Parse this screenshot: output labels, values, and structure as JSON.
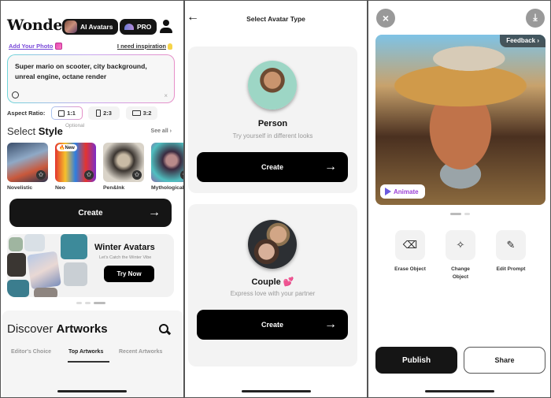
{
  "panel1": {
    "logo": "Wonder",
    "ai_avatars_label": "AI Avatars",
    "pro_label": "PRO",
    "add_photo_label": "Add Your Photo",
    "inspiration_label": "I need inspiration",
    "prompt_value": "Super mario on scooter, city background, unreal engine, octane render",
    "clear_symbol": "×",
    "aspect_ratio_label": "Aspect Ratio:",
    "aspect_ratios": [
      {
        "label": "1:1",
        "selected": true
      },
      {
        "label": "2:3",
        "selected": false
      },
      {
        "label": "3:2",
        "selected": false
      }
    ],
    "select_label": "Select",
    "style_label": "Style",
    "optional_label": "Optional",
    "see_all_label": "See all ›",
    "styles": [
      {
        "label": "Novelistic",
        "badge": ""
      },
      {
        "label": "Neo",
        "badge": "New"
      },
      {
        "label": "Pen&Ink",
        "badge": ""
      },
      {
        "label": "Mythological",
        "badge": ""
      }
    ],
    "star_symbol": "✩",
    "new_fire": "🔥",
    "create_label": "Create",
    "arrow_symbol": "→",
    "banner": {
      "title": "Winter Avatars",
      "subtitle": "Let's Catch the Winter Vibe",
      "button": "Try Now"
    },
    "carousel_active_index": 2,
    "discover_label": "Discover",
    "artworks_label": "Artworks",
    "tabs": [
      {
        "label": "Editor's Choice",
        "active": false
      },
      {
        "label": "Top Artworks",
        "active": true
      },
      {
        "label": "Recent Artworks",
        "active": false
      }
    ]
  },
  "panel2": {
    "back_symbol": "←",
    "title": "Select Avatar Type",
    "cards": [
      {
        "name": "Person",
        "description": "Try yourself in different looks",
        "button": "Create"
      },
      {
        "name": "Couple",
        "emoji": "💕",
        "description": "Express love with your partner",
        "button": "Create"
      }
    ],
    "arrow_symbol": "→"
  },
  "panel3": {
    "close_symbol": "×",
    "download_symbol": "⤓",
    "feedback_label": "Feedback ›",
    "animate_label": "Animate",
    "carousel_active_index": 0,
    "tools": [
      {
        "label": "Erase Object",
        "icon": "eraser-icon",
        "glyph": "⌫"
      },
      {
        "label": "Change Object",
        "icon": "magic-wand-icon",
        "glyph": "✧"
      },
      {
        "label": "Edit Prompt",
        "icon": "edit-icon",
        "glyph": "✎"
      }
    ],
    "publish_label": "Publish",
    "share_label": "Share"
  },
  "colors": {
    "primary_dark": "#151515",
    "accent_purple": "#7a4bd9",
    "accent_pink": "#e8468f",
    "muted_text": "#999999",
    "card_bg": "#f3f3f3"
  }
}
